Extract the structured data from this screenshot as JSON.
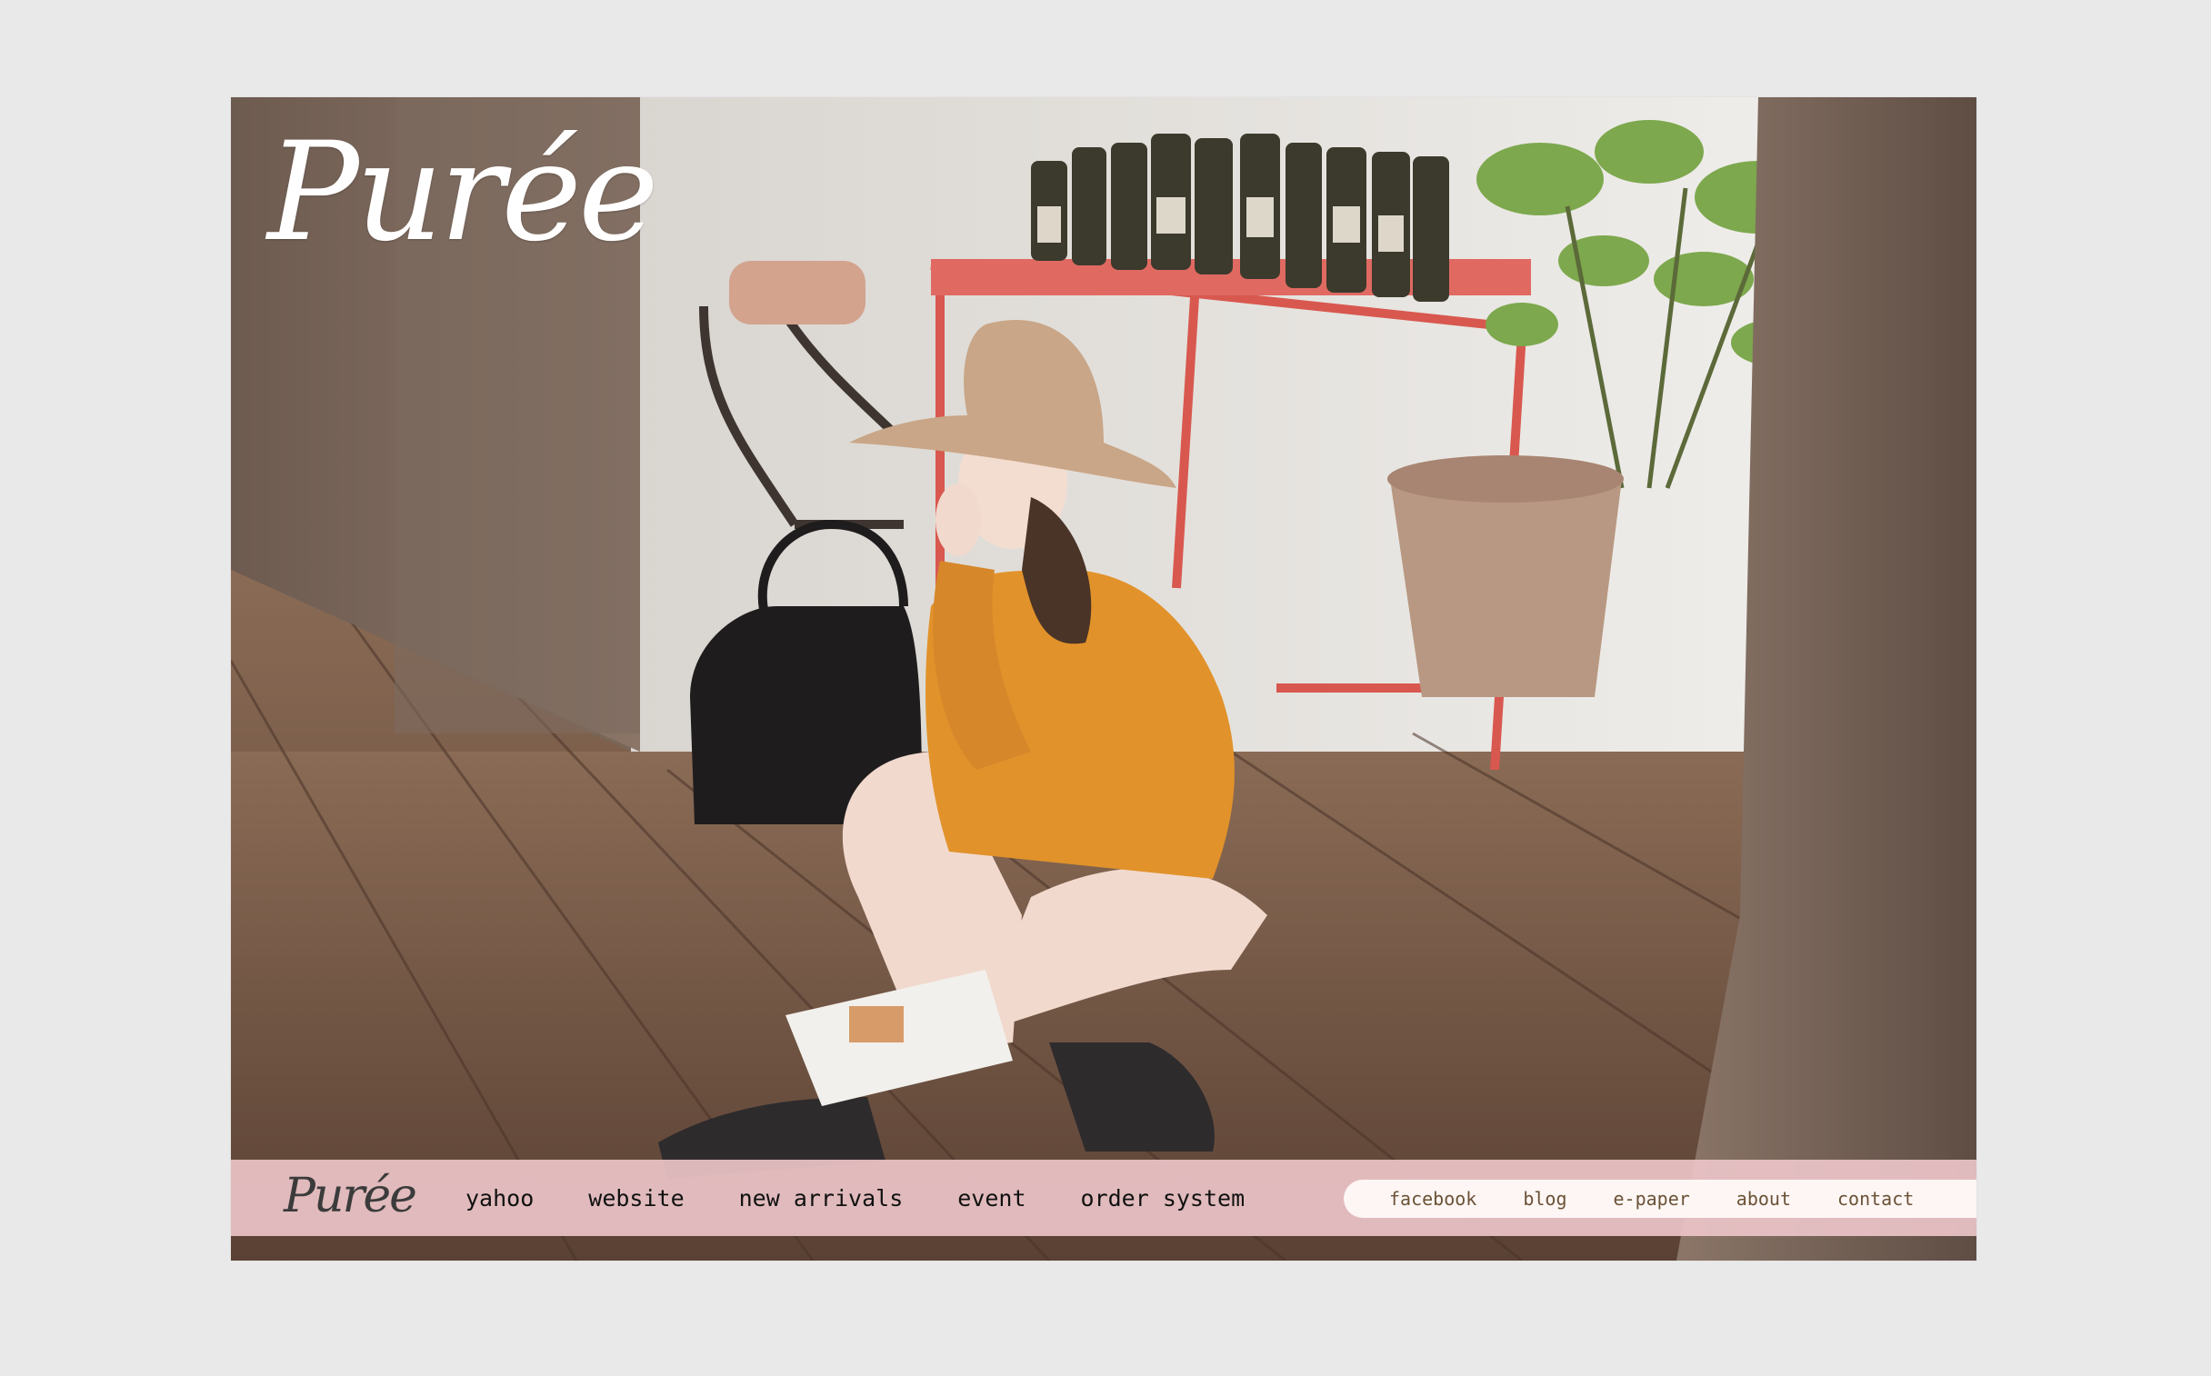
{
  "brand": {
    "logo_text": "Purée",
    "nav_logo_text": "Purée"
  },
  "primary_nav": [
    {
      "label": "yahoo"
    },
    {
      "label": "website"
    },
    {
      "label": "new arrivals"
    },
    {
      "label": "event"
    },
    {
      "label": "order system"
    }
  ],
  "secondary_nav": [
    {
      "label": "facebook"
    },
    {
      "label": "blog"
    },
    {
      "label": "e-paper"
    },
    {
      "label": "about"
    },
    {
      "label": "contact"
    }
  ],
  "colors": {
    "page_background": "#e9e9ea",
    "nav_bar": "#ecc4c8",
    "secondary_pill": "#fdf6f4",
    "secondary_text": "#6a5236"
  }
}
